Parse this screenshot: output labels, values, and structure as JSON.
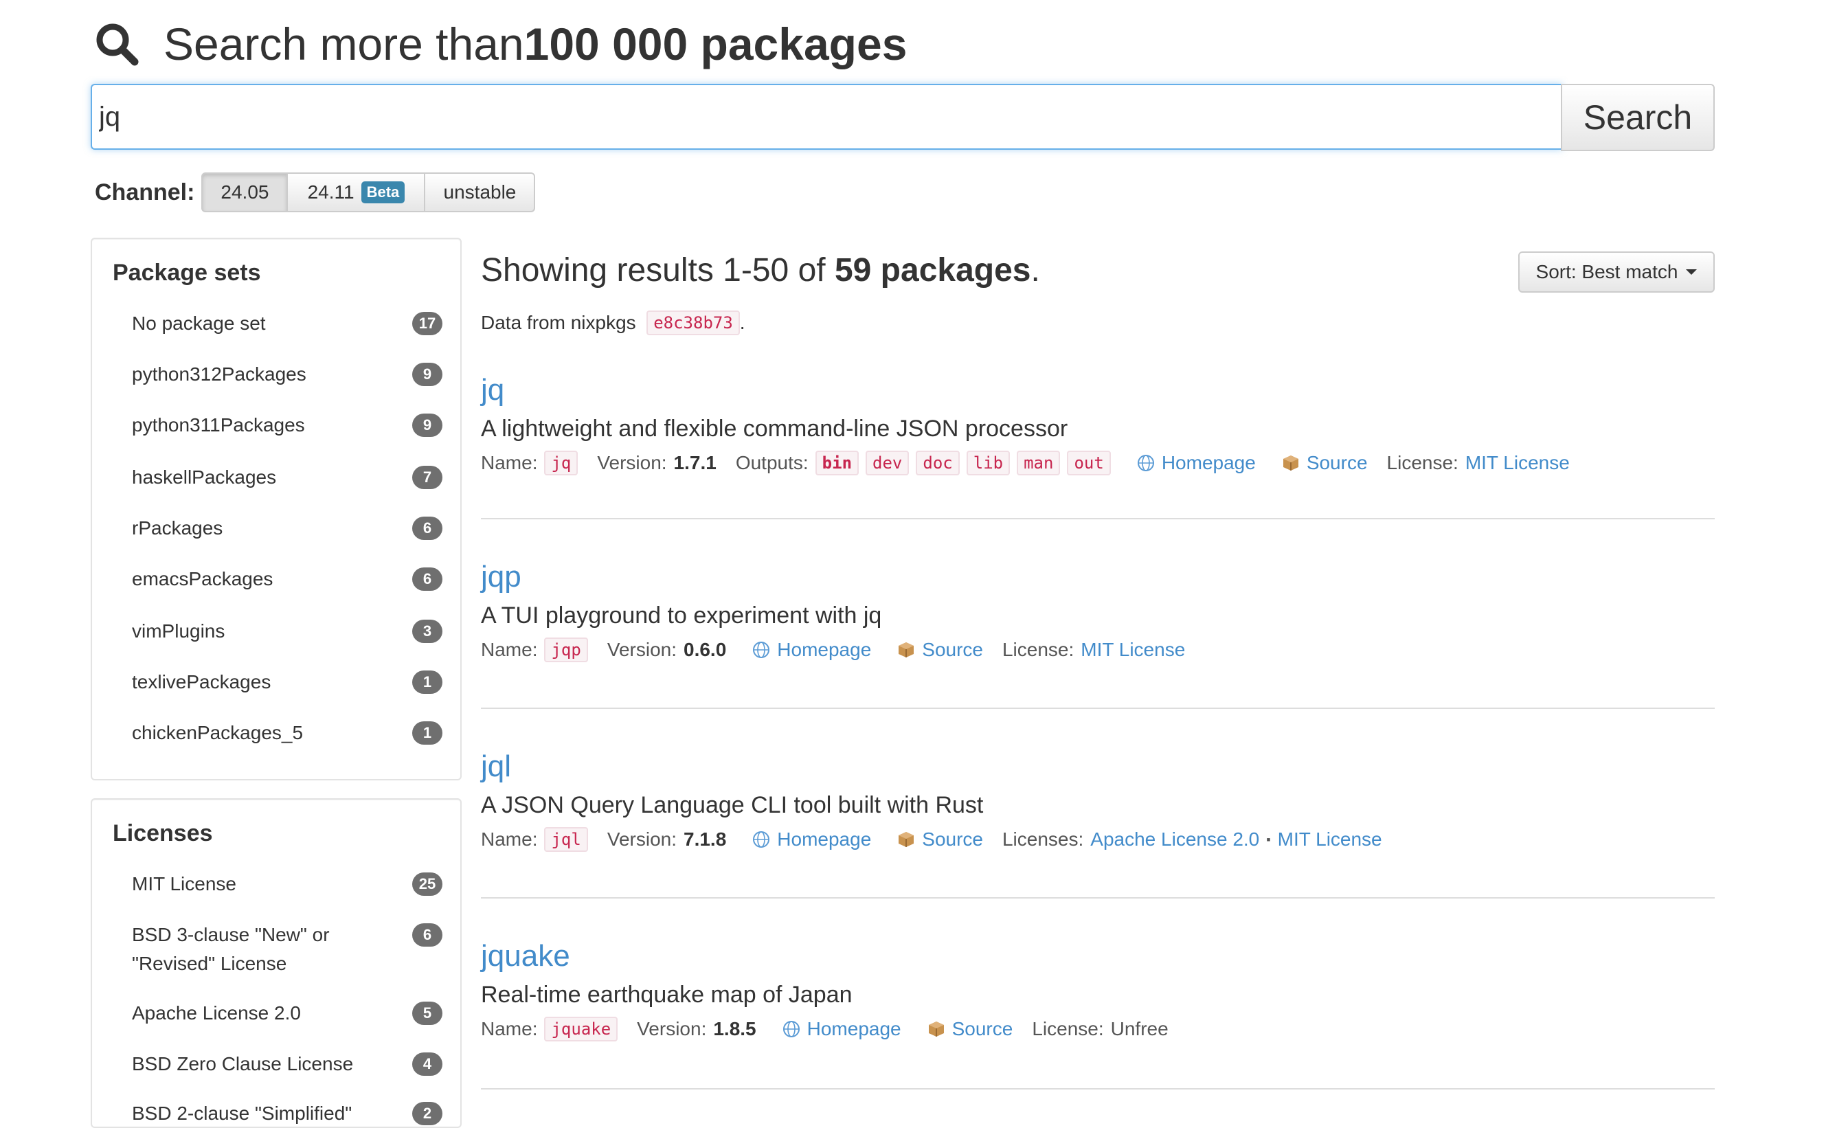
{
  "header": {
    "prefix": "Search more than ",
    "bold": "100 000 packages",
    "icon": "search-icon"
  },
  "search": {
    "value": "jq",
    "button_label": "Search"
  },
  "channel": {
    "label": "Channel:",
    "options": [
      {
        "label": "24.05",
        "badge": ""
      },
      {
        "label": "24.11",
        "badge": "Beta"
      },
      {
        "label": "unstable",
        "badge": ""
      }
    ]
  },
  "package_sets": {
    "title": "Package sets",
    "items": [
      {
        "label": "No package set",
        "count": "17"
      },
      {
        "label": "python312Packages",
        "count": "9"
      },
      {
        "label": "python311Packages",
        "count": "9"
      },
      {
        "label": "haskellPackages",
        "count": "7"
      },
      {
        "label": "rPackages",
        "count": "6"
      },
      {
        "label": "emacsPackages",
        "count": "6"
      },
      {
        "label": "vimPlugins",
        "count": "3"
      },
      {
        "label": "texlivePackages",
        "count": "1"
      },
      {
        "label": "chickenPackages_5",
        "count": "1"
      }
    ]
  },
  "licenses": {
    "title": "Licenses",
    "items": [
      {
        "label": "MIT License",
        "count": "25"
      },
      {
        "label": "BSD 3-clause \"New\" or \"Revised\" License",
        "count": "6"
      },
      {
        "label": "Apache License 2.0",
        "count": "5"
      },
      {
        "label": "BSD Zero Clause License",
        "count": "4"
      },
      {
        "label": "BSD 2-clause \"Simplified\"",
        "count": "2"
      }
    ]
  },
  "results": {
    "prefix": "Showing results 1-50 of ",
    "bold": "59 packages",
    "suffix": ".",
    "sort_label": "Sort: Best match",
    "data_from_label": "Data from nixpkgs",
    "commit": "e8c38b73",
    "commit_suffix": "."
  },
  "labels": {
    "name": "Name:",
    "version": "Version:",
    "outputs": "Outputs:",
    "homepage": "Homepage",
    "source": "Source",
    "license": "License:",
    "licenses": "Licenses:"
  },
  "packages": [
    {
      "name": "jq",
      "description": "A lightweight and flexible command-line JSON processor",
      "attr": "jq",
      "version": "1.7.1",
      "outputs": [
        "bin",
        "dev",
        "doc",
        "lib",
        "man",
        "out"
      ],
      "license": "MIT License"
    },
    {
      "name": "jqp",
      "description": "A TUI playground to experiment with jq",
      "attr": "jqp",
      "version": "0.6.0",
      "license": "MIT License"
    },
    {
      "name": "jql",
      "description": "A JSON Query Language CLI tool built with Rust",
      "attr": "jql",
      "version": "7.1.8",
      "licenses": [
        "Apache License 2.0",
        "MIT License"
      ],
      "license_sep": "▪"
    },
    {
      "name": "jquake",
      "description": "Real-time earthquake map of Japan",
      "attr": "jquake",
      "version": "1.8.5",
      "license": "Unfree"
    }
  ]
}
